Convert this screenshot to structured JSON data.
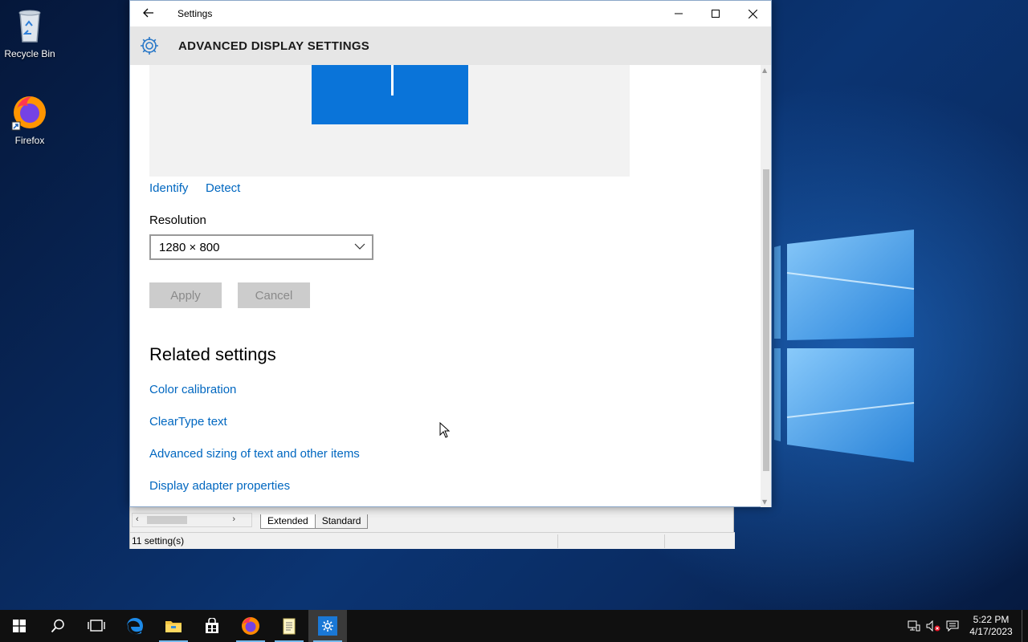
{
  "desktop": {
    "icons": [
      {
        "label": "Recycle Bin",
        "icon": "recycle-bin-icon"
      },
      {
        "label": "Firefox",
        "icon": "firefox-icon"
      }
    ]
  },
  "settings_window": {
    "title": "Settings",
    "header": "ADVANCED DISPLAY SETTINGS",
    "identify_link": "Identify",
    "detect_link": "Detect",
    "resolution_label": "Resolution",
    "resolution_value": "1280 × 800",
    "apply_button": "Apply",
    "cancel_button": "Cancel",
    "related_title": "Related settings",
    "related_links": [
      "Color calibration",
      "ClearType text",
      "Advanced sizing of text and other items",
      "Display adapter properties"
    ]
  },
  "background_window": {
    "tabs": [
      "Extended",
      "Standard"
    ],
    "status": "11 setting(s)"
  },
  "taskbar": {
    "items": [
      "start-icon",
      "search-icon",
      "task-view-icon",
      "edge-icon",
      "file-explorer-icon",
      "store-icon",
      "firefox-icon",
      "notepad-icon",
      "settings-icon"
    ],
    "time": "5:22 PM",
    "date": "4/17/2023"
  },
  "colors": {
    "accent": "#0067c0",
    "monitor_blue": "#0a74d9",
    "taskbar": "#101010"
  }
}
